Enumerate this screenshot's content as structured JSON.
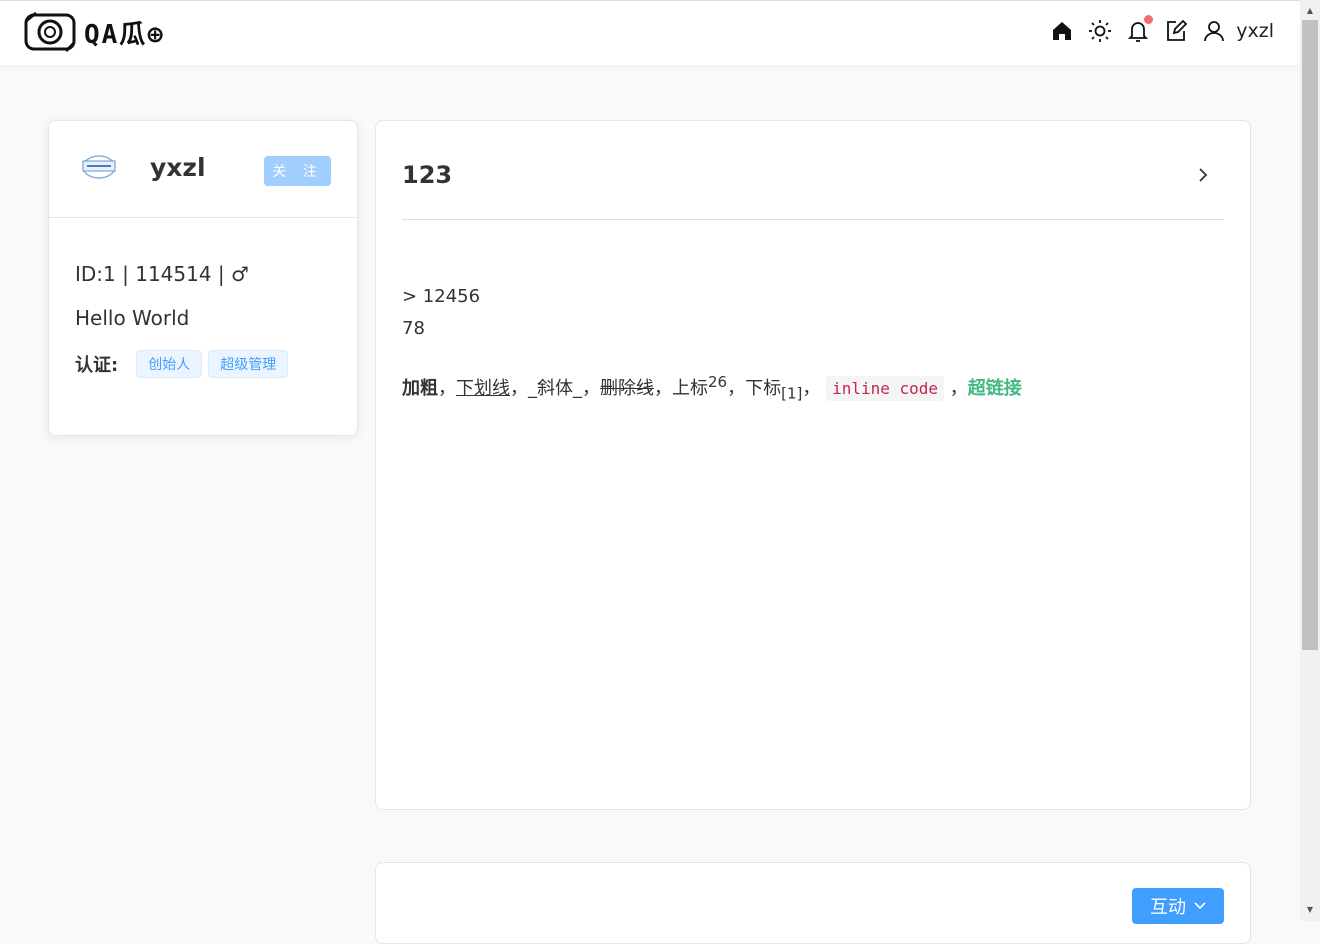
{
  "header": {
    "logo_text": "QA瓜⊕",
    "icons": [
      "home-icon",
      "sun-icon",
      "bell-icon",
      "edit-icon",
      "user-icon"
    ],
    "username": "yxzl",
    "notification_color": "#f56c6c"
  },
  "profile": {
    "username": "yxzl",
    "follow_label": "关 注",
    "meta": "ID:1 | 114514 | ♂",
    "bio": "Hello World",
    "cert_label": "认证:",
    "tags": [
      "创始人",
      "超级管理"
    ]
  },
  "article": {
    "title": "123",
    "quote_line": "> 12456",
    "line2": "78",
    "bold": "加粗",
    "sep": "，",
    "underline": "下划线",
    "italic_md": "_斜体_",
    "strike": "删除线",
    "sup_base": "上标",
    "sup": "26",
    "sub_base": "下标",
    "sub": "[1]",
    "code": "inline code",
    "link": "超链接"
  },
  "bottom": {
    "interact_label": "互动"
  },
  "colors": {
    "primary": "#409eff",
    "follow_bg": "#a0cfff",
    "link": "#42b983",
    "code": "#c7254e"
  }
}
